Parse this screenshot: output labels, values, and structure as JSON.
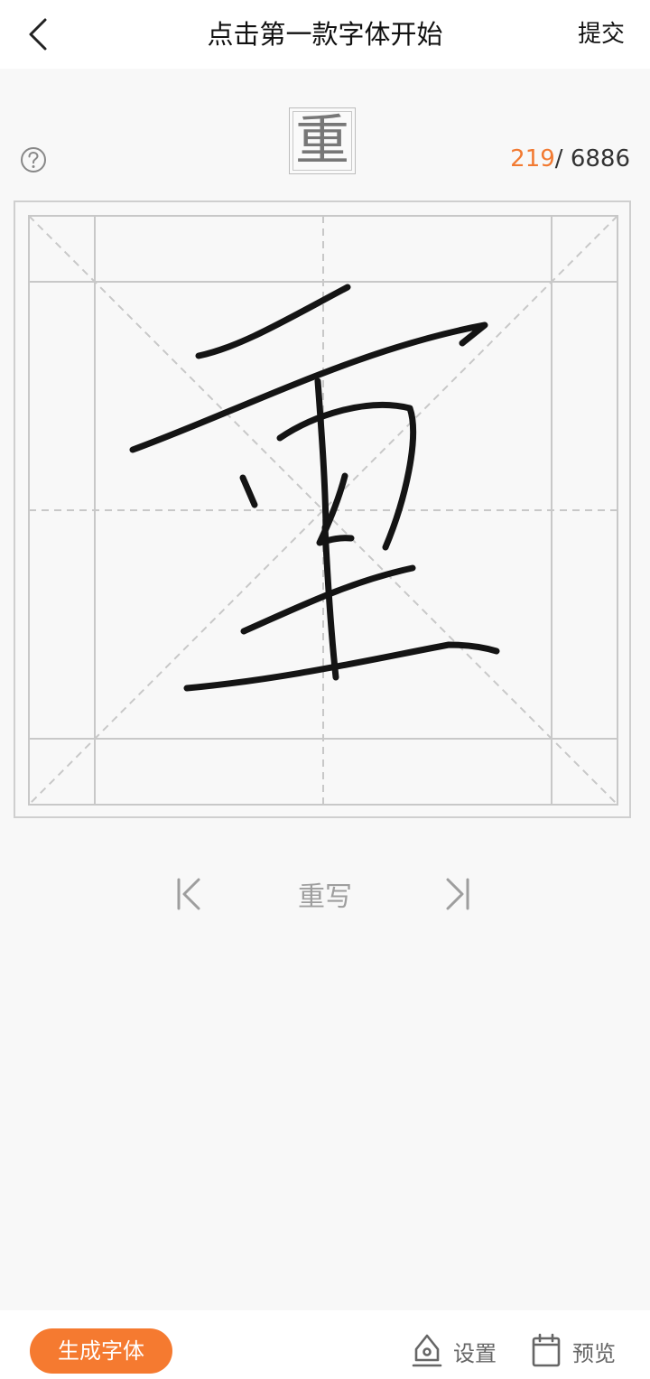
{
  "header": {
    "title": "点击第一款字体开始",
    "submit_label": "提交"
  },
  "character": {
    "glyph": "重",
    "current_index": "219",
    "total": "/ 6886"
  },
  "controls": {
    "rewrite_label": "重写"
  },
  "footer": {
    "generate_label": "生成字体",
    "settings_label": "设置",
    "preview_label": "预览"
  },
  "colors": {
    "accent": "#f57a30",
    "counter": "#f27a31",
    "grid": "#c8c8c8",
    "ink": "#111111"
  }
}
